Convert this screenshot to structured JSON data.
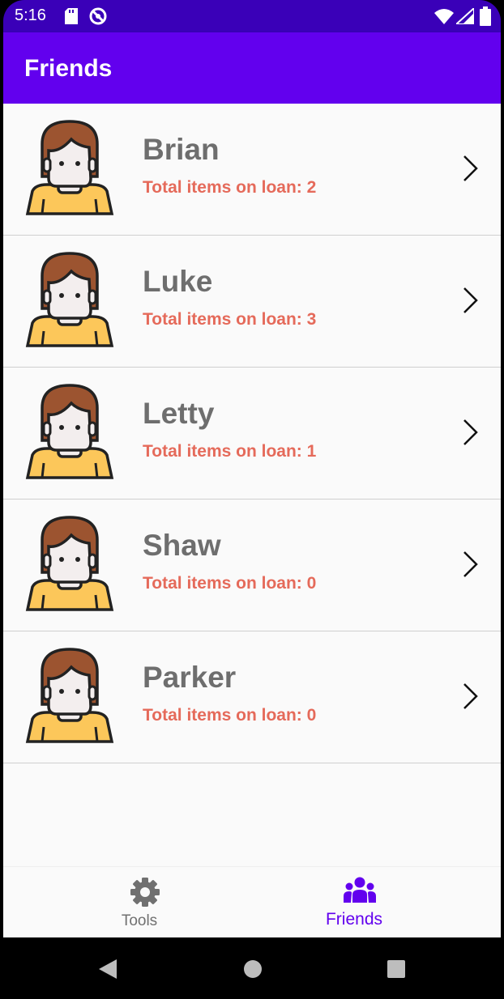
{
  "status_bar": {
    "time": "5:16",
    "icons": [
      "sd-card-icon",
      "do-not-disturb-icon",
      "wifi-icon",
      "signal-icon",
      "battery-icon"
    ]
  },
  "app_bar": {
    "title": "Friends",
    "color": "#6200ee"
  },
  "friends": [
    {
      "name": "Brian",
      "loan_text": "Total items on loan: 2"
    },
    {
      "name": "Luke",
      "loan_text": "Total items on loan: 3"
    },
    {
      "name": "Letty",
      "loan_text": "Total items on loan: 1"
    },
    {
      "name": "Shaw",
      "loan_text": "Total items on loan: 0"
    },
    {
      "name": "Parker",
      "loan_text": "Total items on loan: 0"
    }
  ],
  "bottom_nav": {
    "tools": {
      "label": "Tools",
      "icon": "gear-icon"
    },
    "friends": {
      "label": "Friends",
      "icon": "people-icon",
      "selected": true
    }
  },
  "colors": {
    "accent": "#6200ee",
    "loan_text": "#e56a5a",
    "name_text": "#6e6e6e"
  }
}
